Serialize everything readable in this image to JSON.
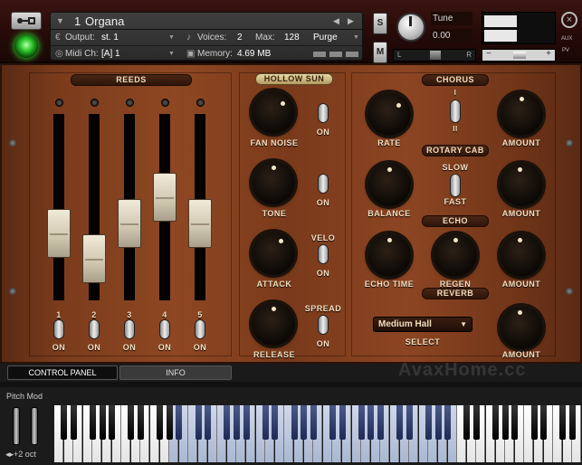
{
  "header": {
    "instrument_index": "1",
    "instrument_name": "Organa",
    "output_label": "Output:",
    "output_value": "st. 1",
    "voices_label": "Voices:",
    "voices_value": "2",
    "max_label": "Max:",
    "max_value": "128",
    "purge_label": "Purge",
    "midi_label": "Midi Ch:",
    "midi_value": "[A] 1",
    "memory_label": "Memory:",
    "memory_value": "4.69 MB",
    "solo_label": "S",
    "mute_label": "M",
    "tune_label": "Tune",
    "tune_value": "0.00",
    "pan_left": "L",
    "pan_right": "R",
    "aux_label": "AUX",
    "pv_label": "PV"
  },
  "reeds": {
    "title": "REEDS",
    "channels": [
      {
        "number": "1",
        "state": "ON",
        "fader_level": 0.38
      },
      {
        "number": "2",
        "state": "ON",
        "fader_level": 0.22
      },
      {
        "number": "3",
        "state": "ON",
        "fader_level": 0.45
      },
      {
        "number": "4",
        "state": "ON",
        "fader_level": 0.62
      },
      {
        "number": "5",
        "state": "ON",
        "fader_level": 0.45
      }
    ]
  },
  "hollow_sun": {
    "title": "HOLLOW SUN",
    "controls": [
      {
        "label": "FAN NOISE",
        "switch_label": "ON"
      },
      {
        "label": "TONE",
        "switch_label": "ON"
      },
      {
        "label": "ATTACK",
        "switch_top_label": "VELO",
        "switch_label": "ON"
      },
      {
        "label": "RELEASE",
        "switch_top_label": "SPREAD",
        "switch_label": "ON"
      }
    ]
  },
  "chorus": {
    "title": "CHORUS",
    "rate_label": "RATE",
    "amount_label": "AMOUNT",
    "switch_top": "I",
    "switch_bottom": "II"
  },
  "rotary": {
    "title": "ROTARY CAB",
    "balance_label": "BALANCE",
    "amount_label": "AMOUNT",
    "slow_label": "SLOW",
    "fast_label": "FAST"
  },
  "echo": {
    "title": "ECHO",
    "time_label": "ECHO TIME",
    "regen_label": "REGEN",
    "amount_label": "AMOUNT"
  },
  "reverb": {
    "title": "REVERB",
    "select_value": "Medium Hall",
    "select_label": "SELECT",
    "amount_label": "AMOUNT"
  },
  "tabs": {
    "control_panel": "CONTROL PANEL",
    "info": "INFO"
  },
  "watermark": "AvaxHome.cc",
  "keyboard": {
    "pitch_mod_label": "Pitch Mod",
    "octave_label": "+2 oct"
  },
  "colors": {
    "wood": "#7b3c1c",
    "header_bg": "#240a08",
    "led_green": "#2cc72a",
    "active_key": "#a9b7d2"
  }
}
